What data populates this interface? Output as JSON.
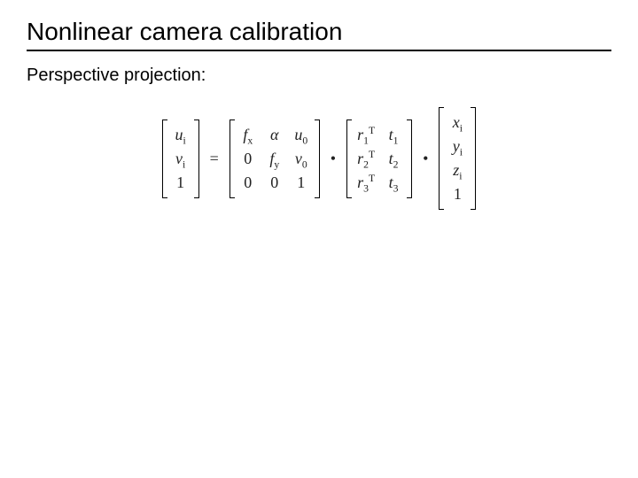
{
  "title": "Nonlinear camera calibration",
  "subhead": "Perspective projection:",
  "ops": {
    "equals": "=",
    "dot": "•"
  },
  "vec_uv": {
    "r1": "u",
    "r1s": "i",
    "r2": "v",
    "r2s": "i",
    "r3": "1"
  },
  "K": {
    "c1": {
      "r1": "f",
      "r1s": "x",
      "r2": "0",
      "r3": "0"
    },
    "c2": {
      "r1": "α",
      "r2": "f",
      "r2s": "y",
      "r3": "0"
    },
    "c3": {
      "r1": "u",
      "r1s": "0",
      "r2": "v",
      "r2s": "0",
      "r3": "1"
    }
  },
  "RT": {
    "rcol": {
      "r1b": "r",
      "r1s": "1",
      "r1t": "T",
      "r2b": "r",
      "r2s": "2",
      "r2t": "T",
      "r3b": "r",
      "r3s": "3",
      "r3t": "T"
    },
    "tcol": {
      "r1b": "t",
      "r1s": "1",
      "r2b": "t",
      "r2s": "2",
      "r3b": "t",
      "r3s": "3"
    }
  },
  "vec_xyz": {
    "r1": "x",
    "r1s": "i",
    "r2": "y",
    "r2s": "i",
    "r3": "z",
    "r3s": "i",
    "r4": "1"
  }
}
